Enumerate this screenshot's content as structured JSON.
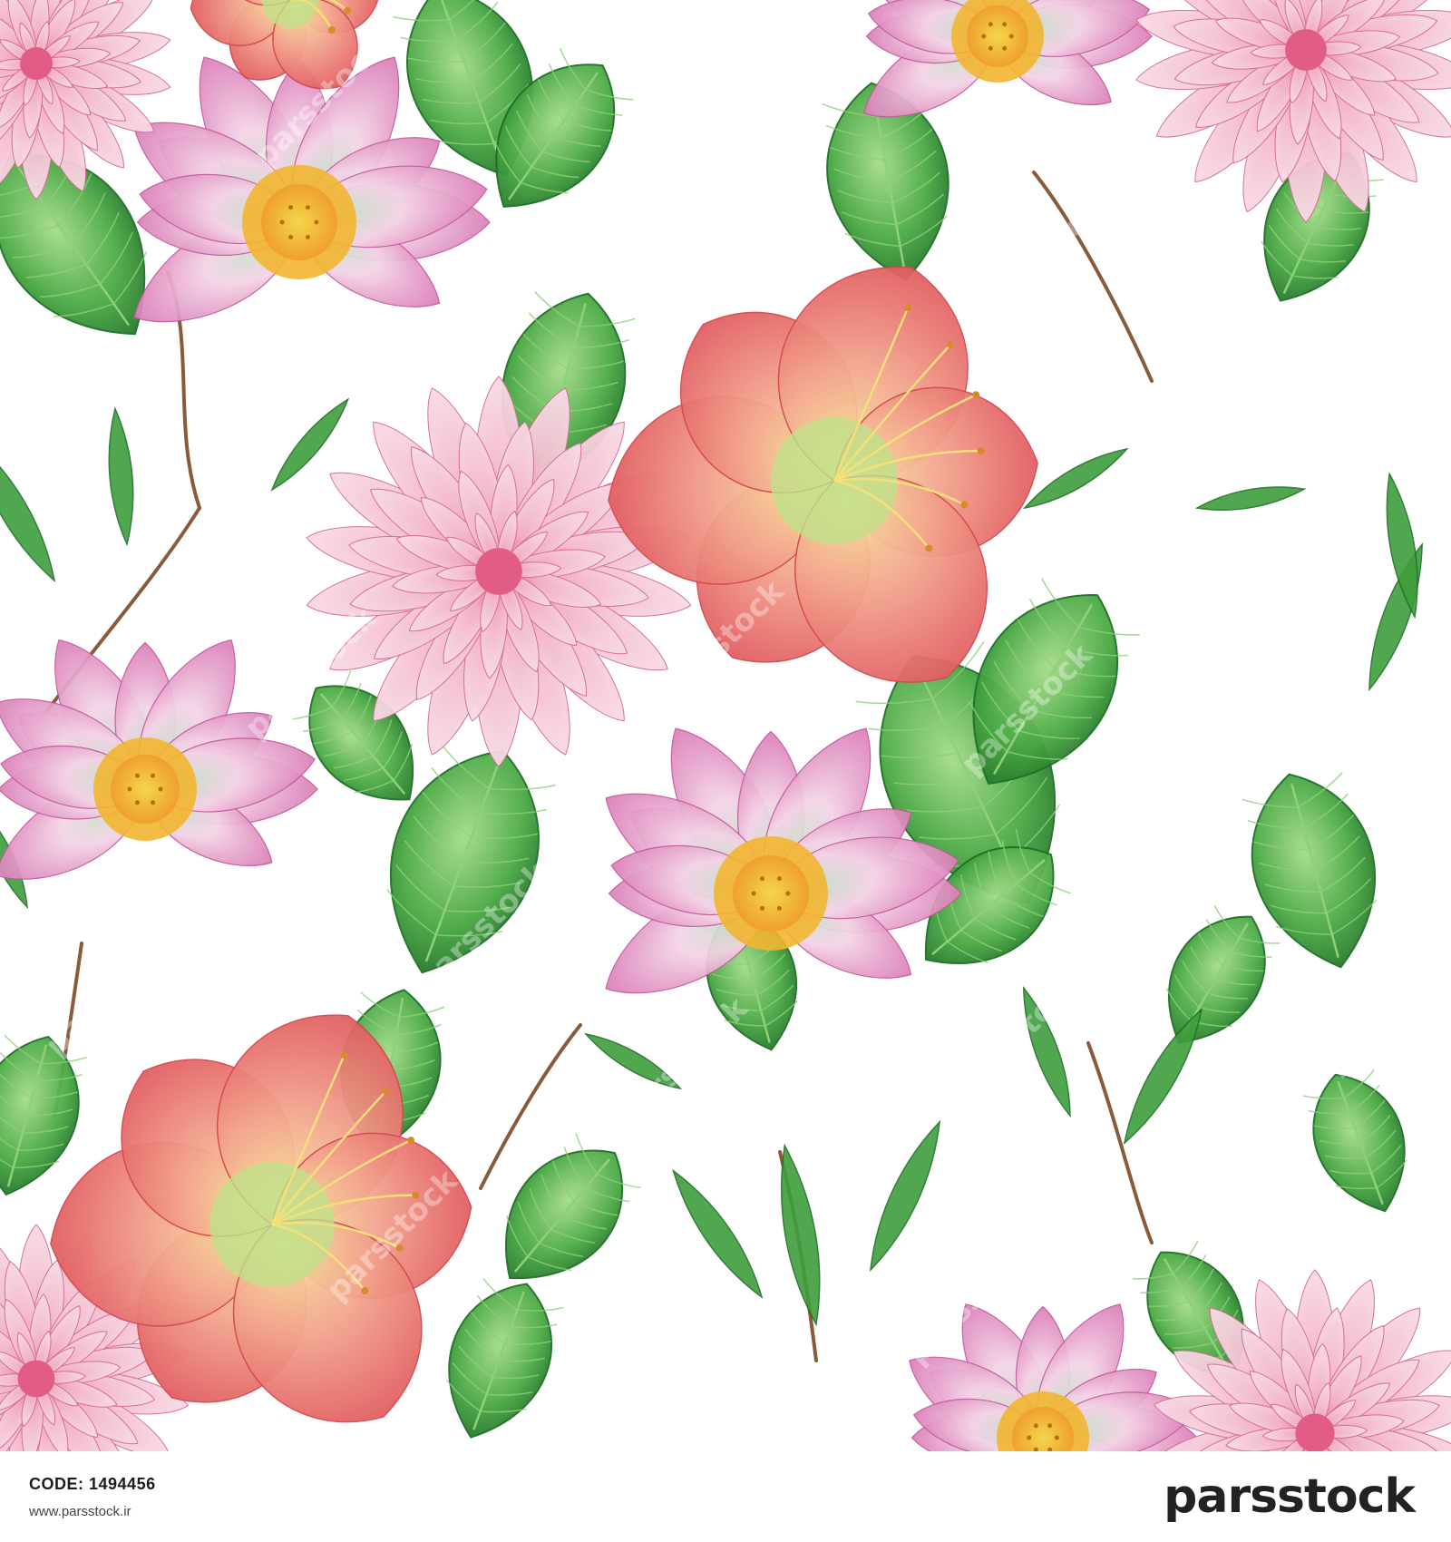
{
  "image": {
    "subject": "seamless watercolor floral pattern",
    "background_color": "#ffffff",
    "colors": {
      "leaf": "#3f9e3c",
      "leaf_light": "#8fd07a",
      "leaf_dark": "#1f6f27",
      "stem": "#8a5a3a",
      "lotus": "#e79cc6",
      "lotus_light": "#f6d6e8",
      "lily": "#ec8f88",
      "lily_core": "#f6d27a",
      "dahlia": "#efb6cc",
      "center": "#f1c23a"
    },
    "flower_kinds": [
      "lotus",
      "daylily",
      "dahlia"
    ],
    "watermark": "parsstock"
  },
  "footer": {
    "code_label": "CODE:",
    "code_value": "1494456",
    "url": "www.parsstock.ir",
    "brand": "parsstock"
  }
}
